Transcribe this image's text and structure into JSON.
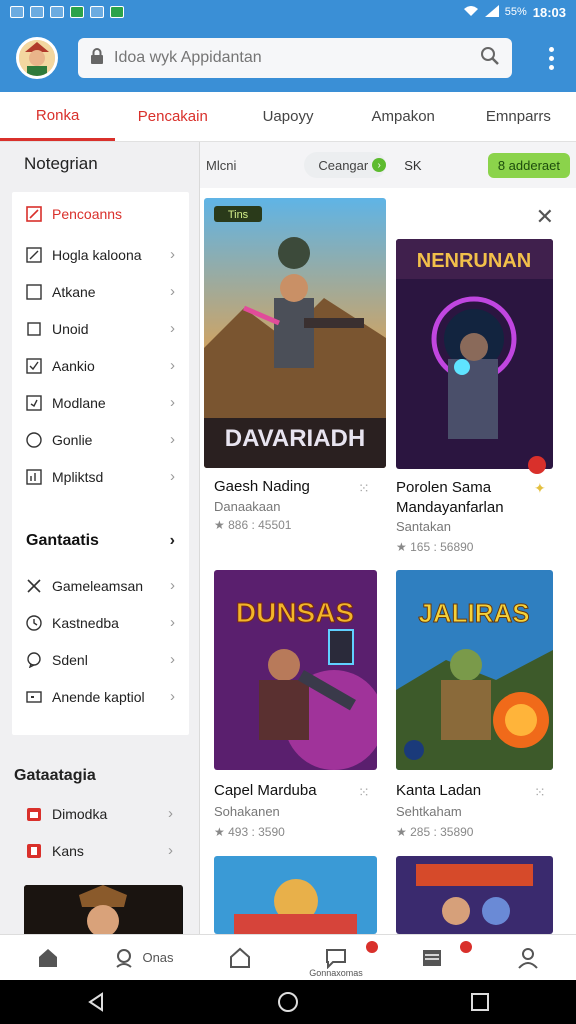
{
  "status_bar": {
    "time": "18:03",
    "signal_text": "55%"
  },
  "app_bar": {
    "search_placeholder": "Idoa wyk Appidantan"
  },
  "tabs": [
    {
      "label": "Ronka",
      "active": true
    },
    {
      "label": "Pencakain",
      "active": false
    },
    {
      "label": "Uapoyy",
      "active": false
    },
    {
      "label": "Ampakon",
      "active": false
    },
    {
      "label": "Emnparrs",
      "active": false
    }
  ],
  "sidebar": {
    "header": "Notegrian",
    "items": [
      {
        "label": "Pencoanns",
        "active": true
      },
      {
        "label": "Hogla kaloona"
      },
      {
        "label": "Atkane"
      },
      {
        "label": "Unoid"
      },
      {
        "label": "Aankio"
      },
      {
        "label": "Modlane"
      },
      {
        "label": "Gonlie"
      },
      {
        "label": "Mpliktsd"
      }
    ],
    "section_games": "Gantaatis",
    "game_items": [
      {
        "label": "Gameleamsan"
      },
      {
        "label": "Kastnedba"
      },
      {
        "label": "Sdenl"
      },
      {
        "label": "Anende kaptiol"
      }
    ],
    "category_title": "Gataatagia",
    "category_items": [
      {
        "label": "Dimodka"
      },
      {
        "label": "Kans"
      }
    ]
  },
  "filter_bar": {
    "chip": "Mlcni",
    "select_label": "Ceangar",
    "sk": "SK",
    "green_button": "8 adderaet"
  },
  "cards": [
    {
      "title": "Gaesh Nading",
      "sub": "Danaakaan",
      "stat": "★ 886 : 45501",
      "poster_text": "DAVARIADH",
      "poster_tag": "Tins"
    },
    {
      "title": "Porolen Sama Mandayanfarlan",
      "sub": "Santakan",
      "stat": "★ 165 : 56890",
      "poster_text": "NENRUNAN"
    },
    {
      "title": "Capel Marduba",
      "sub": "Sohakanen",
      "stat": "★ 493 : 3590",
      "poster_text": "DUNSAS"
    },
    {
      "title": "Kanta Ladan",
      "sub": "Sehtkaham",
      "stat": "★ 285 : 35890",
      "poster_text": "JALIRAS"
    }
  ],
  "bottom_nav": {
    "item2_label": "Onas",
    "item4_label": "Gonnaxomas"
  },
  "colors": {
    "primary": "#3a8fd6",
    "accent": "#d9302b",
    "green": "#8bd34b"
  }
}
